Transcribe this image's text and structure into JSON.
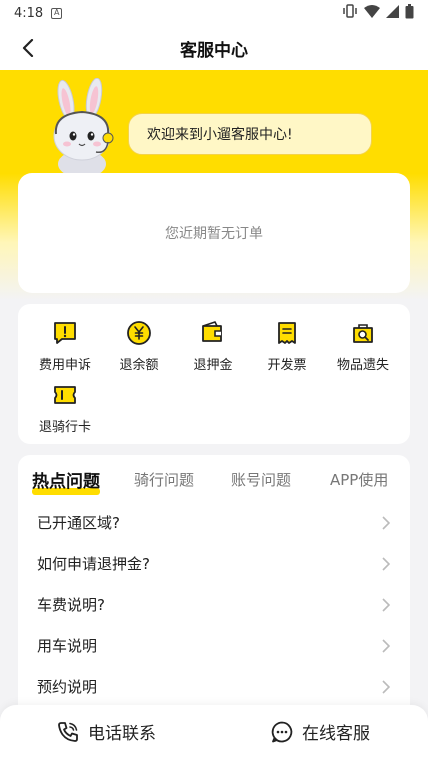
{
  "status_bar": {
    "time": "4:18",
    "notification_badge": "A",
    "icons": [
      "vibrate-icon",
      "wifi-icon",
      "signal-icon",
      "battery-icon"
    ]
  },
  "header": {
    "title": "客服中心",
    "back_icon": "back-arrow-icon"
  },
  "banner": {
    "welcome_text": "欢迎来到小遛客服中心!",
    "accent_color": "#ffdd00"
  },
  "order_card": {
    "empty_text": "您近期暂无订单"
  },
  "services": [
    {
      "label": "费用申诉",
      "icon": "exclamation-message-icon"
    },
    {
      "label": "退余额",
      "icon": "yen-coin-icon"
    },
    {
      "label": "退押金",
      "icon": "wallet-icon"
    },
    {
      "label": "开发票",
      "icon": "invoice-icon"
    },
    {
      "label": "物品遗失",
      "icon": "lost-item-search-icon"
    },
    {
      "label": "退骑行卡",
      "icon": "ticket-card-icon"
    }
  ],
  "faq": {
    "tabs": [
      "热点问题",
      "骑行问题",
      "账号问题",
      "APP使用"
    ],
    "active_tab": "热点问题",
    "items": [
      "已开通区域?",
      "如何申请退押金?",
      "车费说明?",
      "用车说明",
      "预约说明"
    ]
  },
  "bottom_bar": {
    "phone_label": "电话联系",
    "chat_label": "在线客服"
  }
}
